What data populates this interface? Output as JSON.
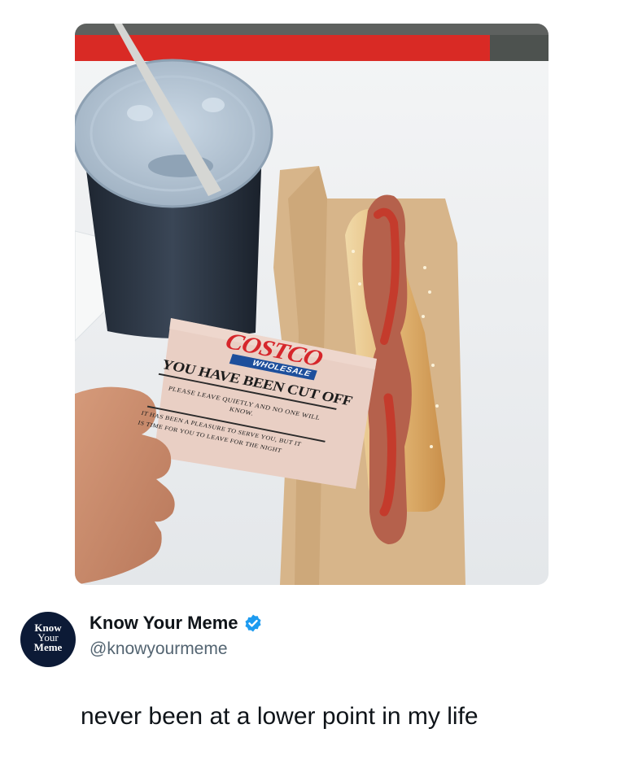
{
  "post": {
    "author": {
      "name": "Know Your Meme",
      "handle": "@knowyourmeme",
      "verified": true,
      "verified_icon": "verified-badge-icon",
      "verified_color": "#1d9bf0",
      "avatar_lines": [
        "Know",
        "Your",
        "Meme"
      ]
    },
    "text": "never been at a lower point in my life"
  },
  "photo": {
    "card": {
      "brand": "COSTCO",
      "brand_sub": "WHOLESALE",
      "heading": "YOU HAVE BEEN CUT OFF",
      "line1": "PLEASE LEAVE QUIETLY AND NO ONE WILL KNOW.",
      "line2a": "IT HAS BEEN A PLEASURE TO SERVE YOU, BUT IT",
      "line2b": "IS TIME FOR YOU TO LEAVE FOR THE NIGHT"
    }
  }
}
